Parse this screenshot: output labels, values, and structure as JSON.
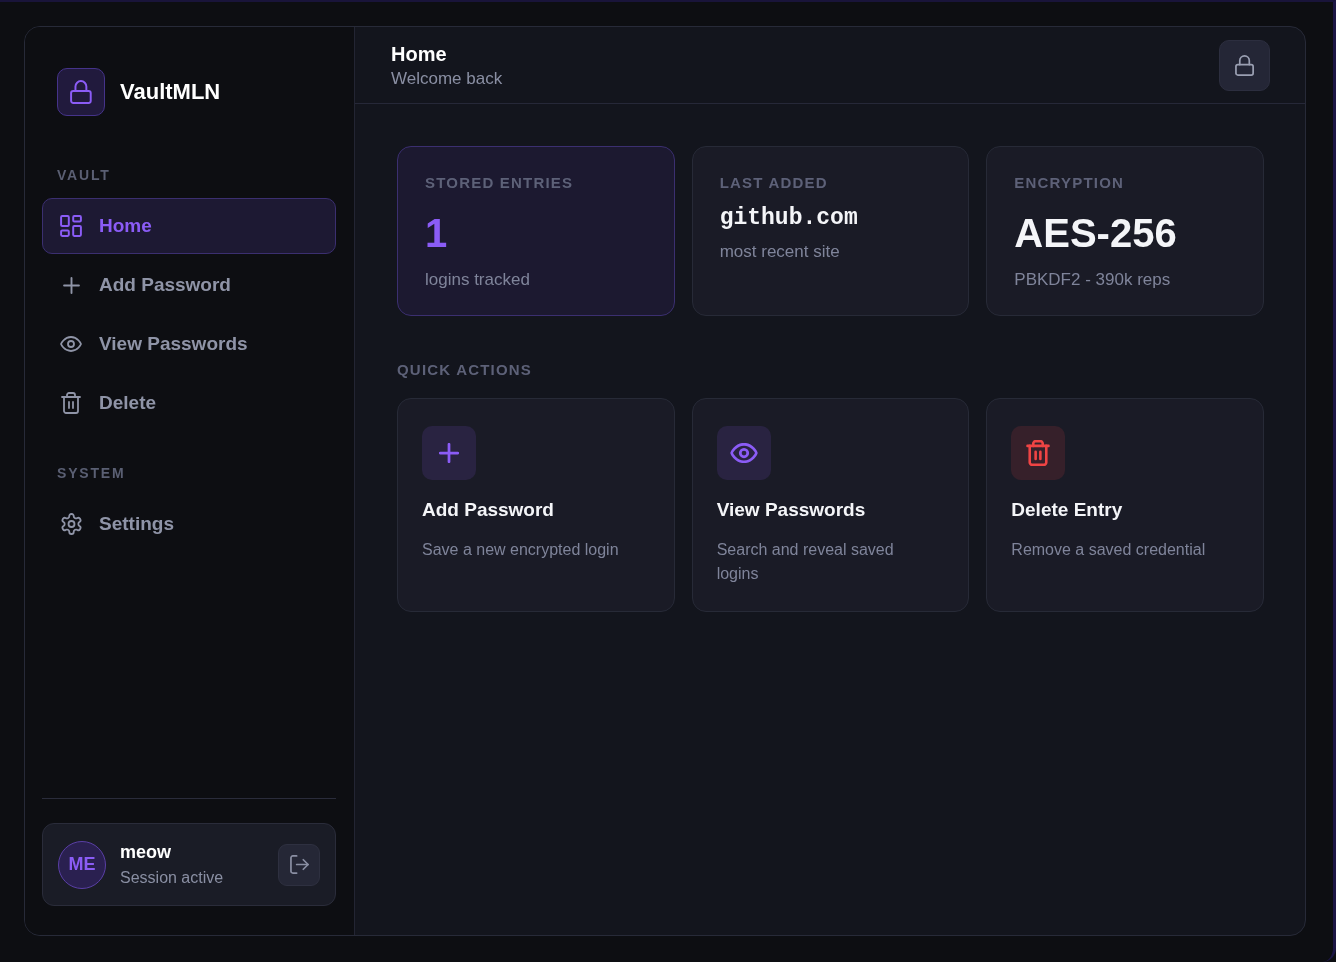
{
  "brand": {
    "name": "VaultMLN"
  },
  "nav": {
    "sections": [
      {
        "label": "VAULT",
        "items": [
          {
            "label": "Home",
            "selected": true
          },
          {
            "label": "Add Password",
            "selected": false
          },
          {
            "label": "View Passwords",
            "selected": false
          },
          {
            "label": "Delete",
            "selected": false
          }
        ]
      },
      {
        "label": "SYSTEM",
        "items": [
          {
            "label": "Settings",
            "selected": false
          }
        ]
      }
    ]
  },
  "user": {
    "initials": "ME",
    "name": "meow",
    "status": "Session active"
  },
  "header": {
    "title": "Home",
    "subtitle": "Welcome back"
  },
  "stats": [
    {
      "kind": "count",
      "label": "STORED ENTRIES",
      "value": "1",
      "caption": "logins tracked",
      "accent": true
    },
    {
      "kind": "code",
      "label": "LAST ADDED",
      "value": "github.com",
      "caption": "most recent site",
      "accent": false
    },
    {
      "kind": "figure",
      "label": "ENCRYPTION",
      "value": "AES-256",
      "caption": "PBKDF2 - 390k reps",
      "accent": false
    }
  ],
  "quick_actions": {
    "label": "QUICK ACTIONS",
    "items": [
      {
        "title": "Add Password",
        "description": "Save a new encrypted login",
        "color": "#8b5cf6"
      },
      {
        "title": "View Passwords",
        "description": "Search and reveal saved logins",
        "color": "#8b5cf6"
      },
      {
        "title": "Delete Entry",
        "description": "Remove a saved credential",
        "color": "#ef4444"
      }
    ]
  }
}
